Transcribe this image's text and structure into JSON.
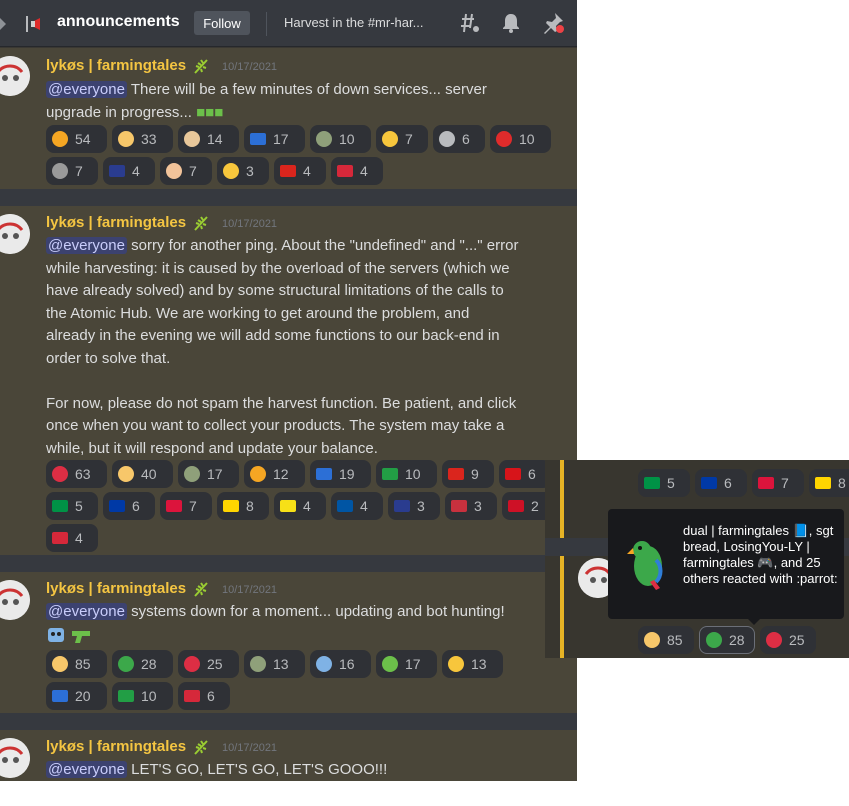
{
  "header": {
    "channel": "announcements",
    "follow_label": "Follow",
    "topic": "Harvest in the #mr-har..."
  },
  "messages": [
    {
      "author": "lykøs | farmingtales",
      "date": "10/17/2021",
      "mention": "@everyone",
      "lines": [
        "There will be a few minutes of down services... server",
        "upgrade in progress..."
      ],
      "reactions": [
        {
          "icon": "sun-emoji",
          "color": "#f5a623",
          "count": "54"
        },
        {
          "icon": "thumbs-up-emoji",
          "color": "#f7c76a",
          "count": "33"
        },
        {
          "icon": "bread-emoji",
          "color": "#e8c79a",
          "count": "14"
        },
        {
          "icon": "philippines-flag",
          "color": "#2c6fd6",
          "count": "17"
        },
        {
          "icon": "money-bag-emoji",
          "color": "#8fa07a",
          "count": "10"
        },
        {
          "icon": "sunglasses-emoji",
          "color": "#f7c63c",
          "count": "7"
        },
        {
          "icon": "alien-emoji",
          "color": "#b9bbbe",
          "count": "6"
        },
        {
          "icon": "hundred-emoji",
          "color": "#e02b2b",
          "count": "10"
        },
        {
          "icon": "fork-knife-emoji",
          "color": "#9a9a9a",
          "count": "7"
        },
        {
          "icon": "australia-flag",
          "color": "#2a3c8f",
          "count": "4"
        },
        {
          "icon": "flexed-biceps-emoji",
          "color": "#f2c39a",
          "count": "7"
        },
        {
          "icon": "hot-face-emoji",
          "color": "#f7c63c",
          "count": "3"
        },
        {
          "icon": "vietnam-flag",
          "color": "#da251d",
          "count": "4"
        },
        {
          "icon": "thailand-flag",
          "color": "#d6283a",
          "count": "4"
        }
      ]
    },
    {
      "author": "lykøs | farmingtales",
      "date": "10/17/2021",
      "mention": "@everyone",
      "lines": [
        "sorry for another ping. About the \"undefined\" and \"...\" error",
        "while harvesting: it is caused by the overload of the servers (which we",
        "have already solved) and by some structural limitations of the calls to",
        "the Atomic Hub. We are working to get around the problem, and",
        "already in the evening we will add some functions to our back-end in",
        "order to solve that.",
        "",
        "For now, please do not spam the harvest function. Be patient, and click",
        "once when you want to collect your products. The system may take a",
        "while, but it will respond and update your balance."
      ],
      "reactions": [
        {
          "icon": "red-heart-emoji",
          "color": "#dd2e44",
          "count": "63"
        },
        {
          "icon": "thumbs-up-emoji",
          "color": "#f7c76a",
          "count": "40"
        },
        {
          "icon": "money-bag-emoji",
          "color": "#8fa07a",
          "count": "17"
        },
        {
          "icon": "sun-emoji",
          "color": "#f5a623",
          "count": "12"
        },
        {
          "icon": "philippines-flag",
          "color": "#2c6fd6",
          "count": "19"
        },
        {
          "icon": "brazil-flag",
          "color": "#229e45",
          "count": "10"
        },
        {
          "icon": "vietnam-flag",
          "color": "#da251d",
          "count": "9"
        },
        {
          "icon": "czech-flag",
          "color": "#d7141a",
          "count": "6"
        },
        {
          "icon": "italy-flag",
          "color": "#009246",
          "count": "5"
        },
        {
          "icon": "russia-flag",
          "color": "#0039a6",
          "count": "6"
        },
        {
          "icon": "poland-flag",
          "color": "#dc143c",
          "count": "7"
        },
        {
          "icon": "ukraine-flag",
          "color": "#ffd500",
          "count": "8"
        },
        {
          "icon": "brunei-flag",
          "color": "#f7e017",
          "count": "4"
        },
        {
          "icon": "france-flag",
          "color": "#0055a4",
          "count": "4"
        },
        {
          "icon": "australia-flag",
          "color": "#2a3c8f",
          "count": "3"
        },
        {
          "icon": "belarus-flag",
          "color": "#c8313e",
          "count": "3"
        },
        {
          "icon": "indonesia-flag",
          "color": "#ce1126",
          "count": "2"
        },
        {
          "icon": "thailand-flag",
          "color": "#d6283a",
          "count": "4"
        }
      ]
    },
    {
      "author": "lykøs | farmingtales",
      "date": "10/17/2021",
      "mention": "@everyone",
      "lines": [
        "systems down for a moment... updating and bot hunting!"
      ],
      "reactions": [
        {
          "icon": "thumbs-up-emoji",
          "color": "#f7c76a",
          "count": "85"
        },
        {
          "icon": "parrot-emoji",
          "color": "#3ca84a",
          "count": "28"
        },
        {
          "icon": "red-heart-emoji",
          "color": "#dd2e44",
          "count": "25"
        },
        {
          "icon": "money-bag-emoji",
          "color": "#8fa07a",
          "count": "13"
        },
        {
          "icon": "robot-emoji",
          "color": "#7fb2e5",
          "count": "16"
        },
        {
          "icon": "water-pistol-emoji",
          "color": "#6cc04a",
          "count": "17"
        },
        {
          "icon": "partying-face-emoji",
          "color": "#f7c63c",
          "count": "13"
        },
        {
          "icon": "philippines-flag",
          "color": "#2c6fd6",
          "count": "20"
        },
        {
          "icon": "brazil-flag",
          "color": "#229e45",
          "count": "10"
        },
        {
          "icon": "thailand-flag",
          "color": "#d6283a",
          "count": "6"
        }
      ]
    },
    {
      "author": "lykøs | farmingtales",
      "date": "10/17/2021",
      "mention": "@everyone",
      "lines": [
        "LET'S GO, LET'S GO, LET'S GOOO!!!"
      ],
      "reactions": []
    }
  ],
  "popup": {
    "top_row": [
      {
        "icon": "italy-flag",
        "color": "#009246",
        "count": "5"
      },
      {
        "icon": "russia-flag",
        "color": "#0039a6",
        "count": "6"
      },
      {
        "icon": "poland-flag",
        "color": "#dc143c",
        "count": "7"
      },
      {
        "icon": "ukraine-flag",
        "color": "#ffd500",
        "count": "8"
      }
    ],
    "bottom_row": [
      {
        "icon": "thumbs-up-emoji",
        "color": "#f7c76a",
        "count": "85"
      },
      {
        "icon": "parrot-emoji",
        "color": "#3ca84a",
        "count": "28"
      },
      {
        "icon": "red-heart-emoji",
        "color": "#dd2e44",
        "count": "25"
      }
    ],
    "tooltip_text": "dual | farmingtales 📘, sgt bread, LosingYou-LY | farmingtales 🎮, and 25 others reacted with :parrot:"
  }
}
